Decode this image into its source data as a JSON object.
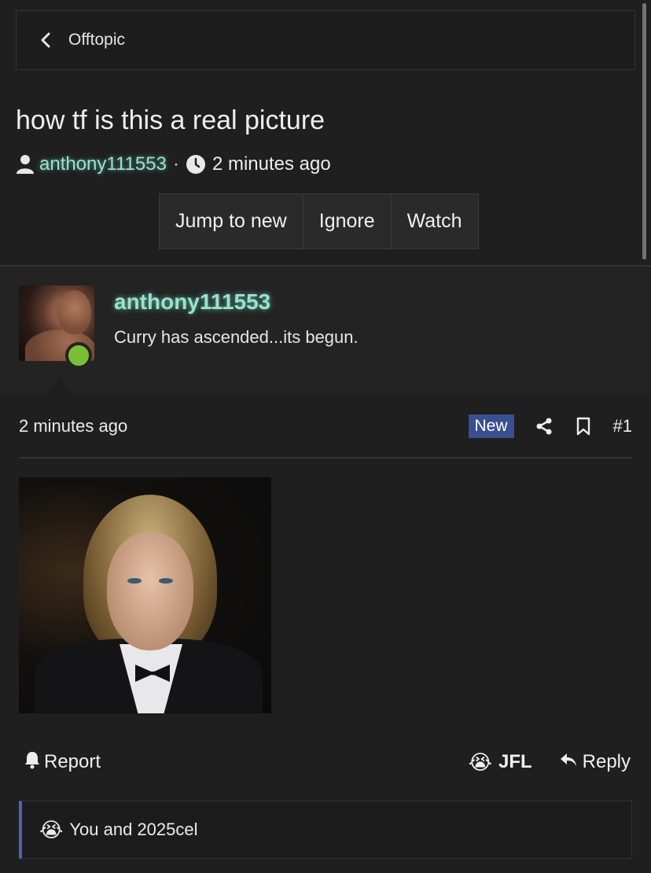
{
  "breadcrumb": {
    "label": "Offtopic"
  },
  "thread": {
    "title": "how tf is this a real picture",
    "author": "anthony111553",
    "separator": "·",
    "time": "2 minutes ago"
  },
  "actions": {
    "jump_label": "Jump to new",
    "ignore_label": "Ignore",
    "watch_label": "Watch"
  },
  "post": {
    "author": "anthony111553",
    "status": "Curry has ascended...its begun.",
    "time": "2 minutes ago",
    "badge": "New",
    "number": "#1"
  },
  "footer": {
    "report_label": "Report",
    "reaction_label": "JFL",
    "reaction_emoji": "😭",
    "reply_label": "Reply"
  },
  "reactions": {
    "emoji": "😭",
    "text": "You and 2025cel"
  },
  "colors": {
    "username": "#9be0cf",
    "badge": "#3a4f8f",
    "online": "#7cbf34",
    "reaction_accent": "#5361b5"
  }
}
